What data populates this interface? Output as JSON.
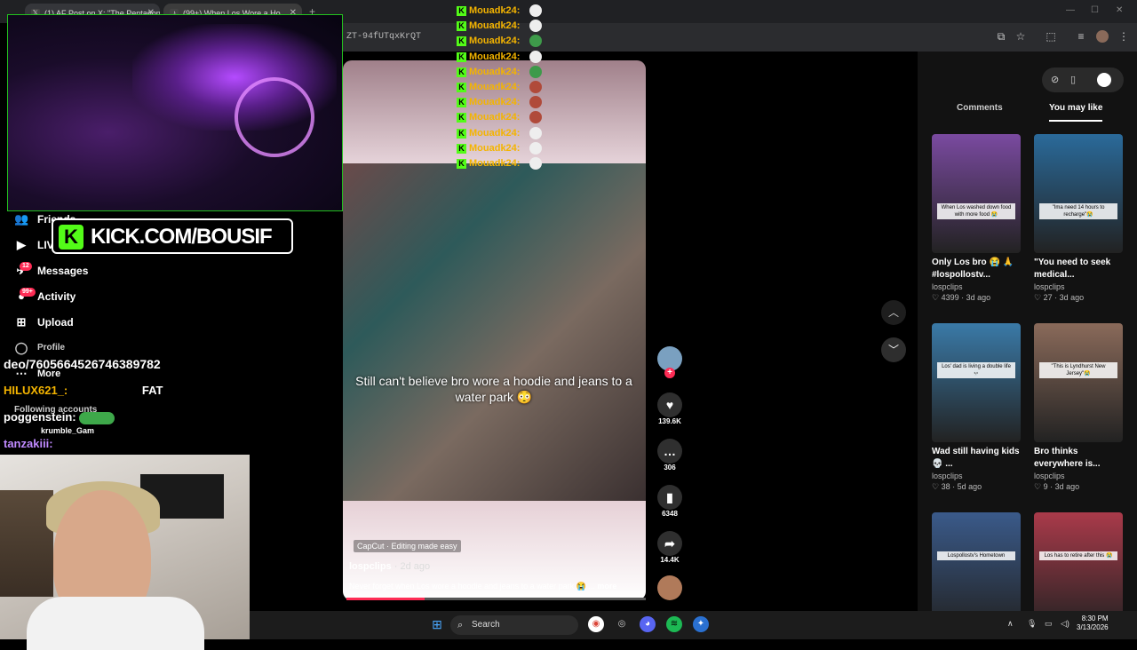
{
  "browser": {
    "tabs": [
      {
        "label": "(1) AF Post on X: \"The Pentagon"
      },
      {
        "label": "(99+) When Los Wore a Ho..."
      }
    ],
    "url": "ZT-94fUTqxKrQT",
    "new_tab": "+",
    "minimize": "—",
    "maximize": "☐",
    "close": "✕"
  },
  "sidebar": {
    "items": [
      {
        "label": "Friends",
        "icon": "friends-icon"
      },
      {
        "label": "LIVE",
        "icon": "live-icon"
      },
      {
        "label": "Messages",
        "icon": "messages-icon",
        "badge": "12"
      },
      {
        "label": "Activity",
        "icon": "activity-icon",
        "badge": "99+"
      },
      {
        "label": "Upload",
        "icon": "upload-icon"
      },
      {
        "label": "Profile",
        "icon": "profile-icon"
      },
      {
        "label": "More",
        "icon": "more-icon"
      }
    ],
    "following_label": "Following accounts",
    "following_user": "krumble_Gam"
  },
  "overlay": {
    "kick_banner": "KICK.COM/BOUSIF",
    "chat_user": "Mouadk24:",
    "chat_lines": 11,
    "left_chat": [
      {
        "text": "deo/7605664526746389782"
      },
      {
        "user": "HILUX621_:",
        "msg": "FAT"
      },
      {
        "user": "poggenstein:",
        "msg": ""
      },
      {
        "user": "tanzakiii:",
        "msg": ""
      }
    ]
  },
  "video": {
    "caption": "Still can't believe bro wore a hoodie and jeans to a water park 😳",
    "capcut": "CapCut · Editing made easy",
    "author": "lospclips",
    "ago": "· 2d ago",
    "description": "Never forget when Los wore a hoodie and jeans to a water park 😭 ...",
    "more": "more",
    "progress": 0.26,
    "likes": "139.6K",
    "comments": "306",
    "saves": "6348",
    "shares": "14.4K"
  },
  "rightpanel": {
    "tab_comments": "Comments",
    "tab_youmaylike": "You may like",
    "cards": [
      {
        "title": "Only Los bro 😭 🙏 #lospollostv...",
        "user": "lospclips",
        "likes": "4399",
        "ago": "3d ago",
        "color": "#7a4aa0",
        "overlay": "When Los washed down food with more food 😭"
      },
      {
        "title": "\"You need to seek medical...",
        "user": "lospclips",
        "likes": "27",
        "ago": "3d ago",
        "color": "#2a6a9a",
        "overlay": "\"Ima need 14 hours to recharge\"😭"
      },
      {
        "title": "Wad still having kids 💀 ...",
        "user": "lospclips",
        "likes": "38",
        "ago": "5d ago",
        "color": "#3a7aa8",
        "overlay": "Los' dad is living a double life 💀"
      },
      {
        "title": "Bro thinks everywhere is...",
        "user": "lospclips",
        "likes": "9",
        "ago": "3d ago",
        "color": "#8a6a5a",
        "overlay": "\"This is Lyndhurst New Jersey\"😭"
      },
      {
        "title": "",
        "user": "",
        "likes": "",
        "ago": "",
        "color": "#3a5a8a",
        "overlay": "Lospollostv's Hometown"
      },
      {
        "title": "",
        "user": "",
        "likes": "",
        "ago": "",
        "color": "#aa3a4a",
        "overlay": "Los has to retire after this 😭"
      }
    ]
  },
  "taskbar": {
    "search": "Search",
    "time": "8:30 PM",
    "date": "3/13/2026"
  },
  "colors": {
    "kick_green": "#53fc18",
    "tiktok_red": "#fe2c55",
    "chat_gold": "#f4b400"
  }
}
